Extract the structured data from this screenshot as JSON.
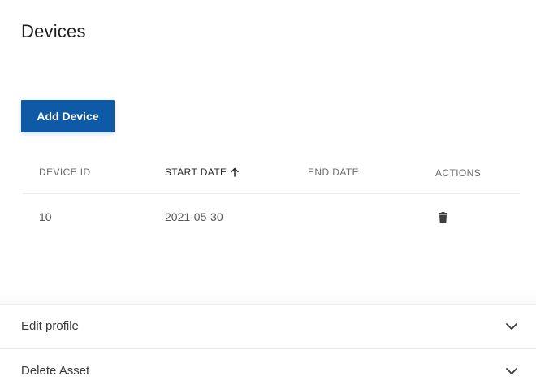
{
  "page": {
    "title": "Devices"
  },
  "toolbar": {
    "add_label": "Add Device"
  },
  "table": {
    "columns": [
      {
        "label": "DEVICE ID",
        "sorted": false
      },
      {
        "label": "START DATE",
        "sorted": true,
        "sort_direction": "ascending"
      },
      {
        "label": "END DATE",
        "sorted": false
      },
      {
        "label": "ACTIONS",
        "sorted": false
      }
    ],
    "rows": [
      {
        "device_id": "10",
        "start_date": "2021-05-30",
        "end_date": "",
        "action_icon": "trash-icon"
      }
    ]
  },
  "panels": [
    {
      "label": "Edit profile",
      "icon": "chevron-down-icon"
    },
    {
      "label": "Delete Asset",
      "icon": "chevron-down-icon"
    }
  ],
  "colors": {
    "accent": "#0e5aa7",
    "text": "#2b2b2b",
    "muted": "#6b6b6b"
  }
}
